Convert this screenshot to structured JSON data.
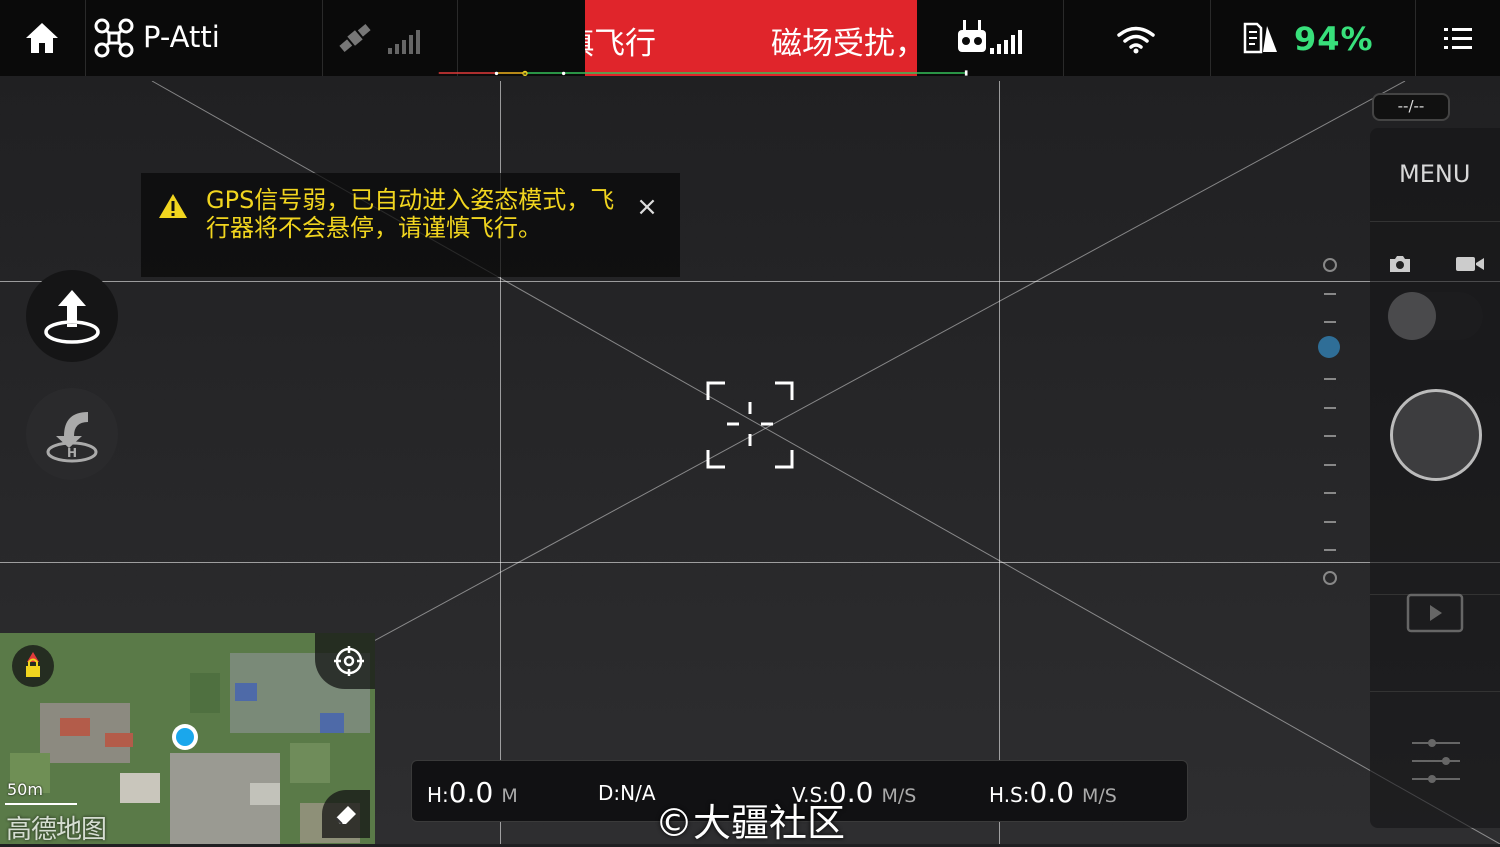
{
  "topbar": {
    "mode": "P-Atti",
    "scroll_warning_a": "慎飞行",
    "scroll_warning_b": "磁场受扰，",
    "battery": "94%"
  },
  "gimbal_readout": "--/--",
  "menu_label": "MENU",
  "alert": {
    "text": "GPS信号弱，已自动进入姿态模式，飞行器将不会悬停，请谨慎飞行。",
    "close": "×"
  },
  "map": {
    "scale": "50m",
    "logo": "高德地图"
  },
  "telemetry": {
    "h_key": "H:",
    "h_val": "0.0",
    "h_unit": "M",
    "d_key": "D:N/A",
    "vs_key": "V.S:",
    "vs_val": "0.0",
    "vs_unit": "M/S",
    "hs_key": "H.S:",
    "hs_val": "0.0",
    "hs_unit": "M/S"
  },
  "watermark": "©大疆社区",
  "colors": {
    "warning_red": "#e0252b",
    "battery_green": "#38e07b",
    "alert_yellow": "#f1d51f",
    "progress_red": "#e23b3b",
    "progress_orange": "#f0b21d",
    "progress_green": "#35c25a"
  }
}
